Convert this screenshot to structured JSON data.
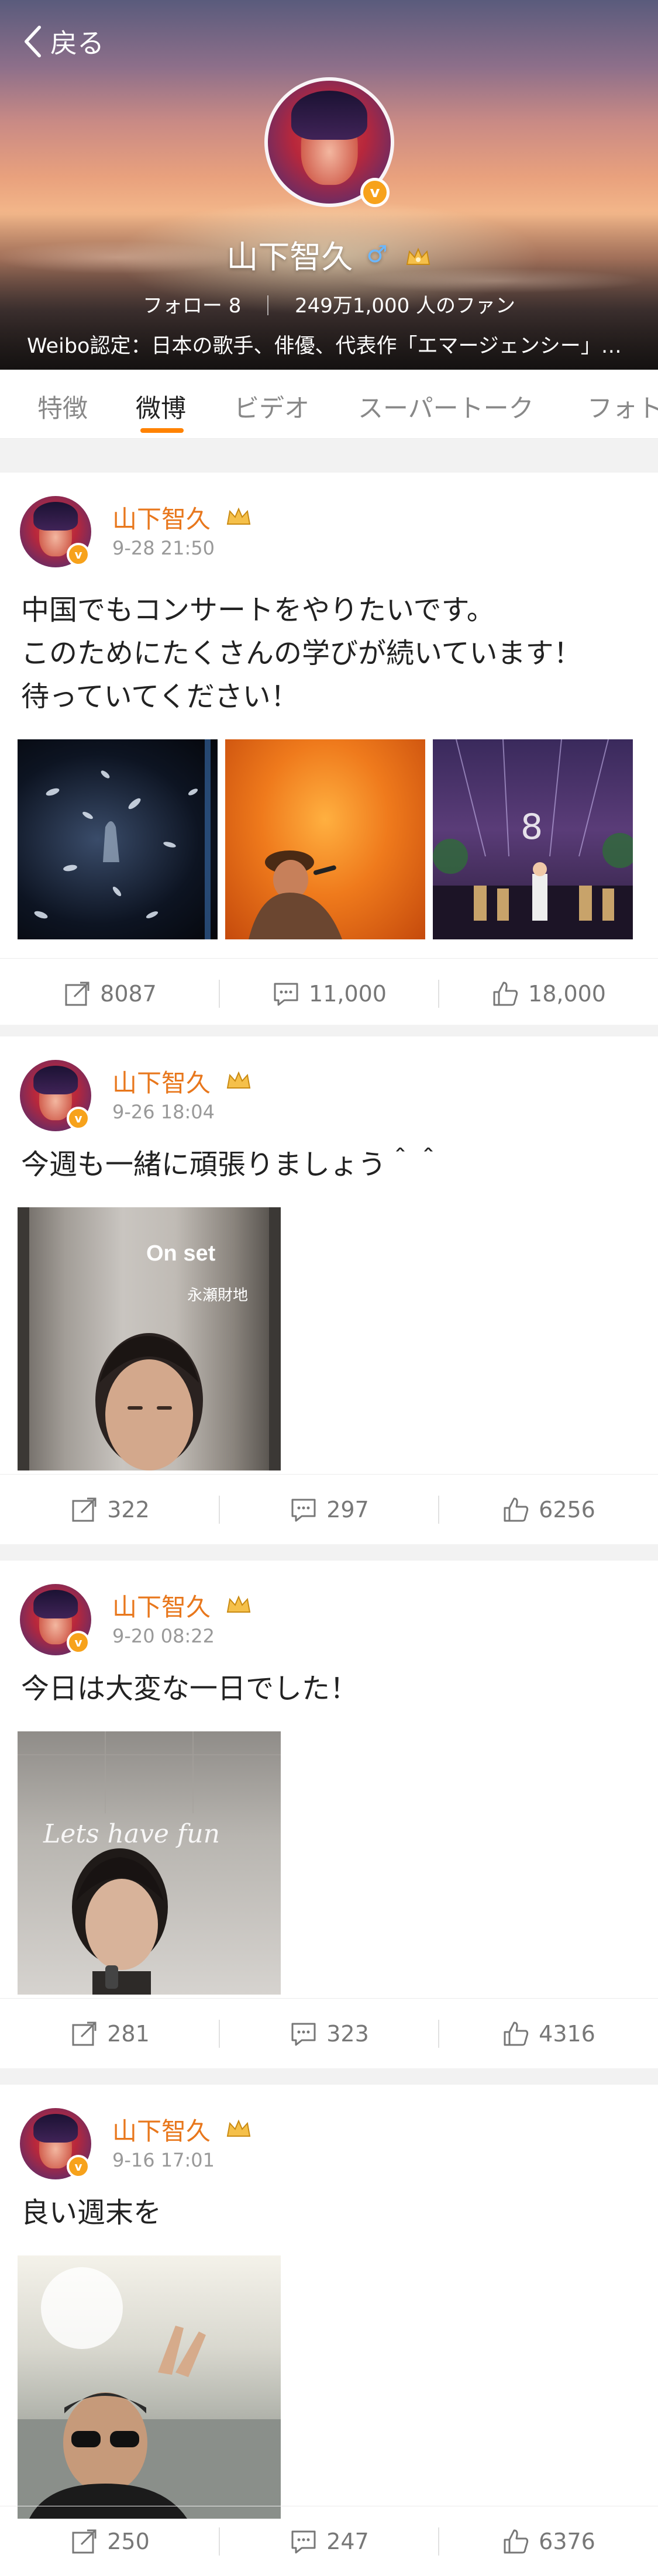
{
  "header": {
    "back_label": "戻る",
    "name": "山下智久",
    "gender_symbol": "♂",
    "verified_badge": "v",
    "follow_text": "フォロー 8",
    "fans_text": "249万1,000 人のファン",
    "verification": "Weibo認定：日本の歌手、俳優、代表作「エマージェンシー」…"
  },
  "tabs": [
    {
      "label": "特徴",
      "active": false
    },
    {
      "label": "微博",
      "active": true
    },
    {
      "label": "ビデオ",
      "active": false
    },
    {
      "label": "スーパートーク",
      "active": false
    },
    {
      "label": "フォト",
      "active": false
    }
  ],
  "posts": [
    {
      "author": "山下智久",
      "time": "9-28 21:50",
      "text": "中国でもコンサートをやりたいです。\nこのためにたくさんの学びが続いています！\n待っていてください！",
      "photos": [
        "concert-petals",
        "concert-singer-orange",
        "concert-stage-dancers"
      ],
      "reposts": "8087",
      "comments": "11,000",
      "likes": "18,000"
    },
    {
      "author": "山下智久",
      "time": "9-26 18:04",
      "text": "今週も一緒に頑張りましょう＾＾",
      "photos": [
        "elevator-selfie"
      ],
      "photo_overlay_title": "On set",
      "photo_overlay_sub": "永瀬財地",
      "reposts": "322",
      "comments": "297",
      "likes": "6256"
    },
    {
      "author": "山下智久",
      "time": "9-20 08:22",
      "text": "今日は大変な一日でした！",
      "photos": [
        "mirror-selfie"
      ],
      "photo_overlay_title": "Lets have fun",
      "reposts": "281",
      "comments": "323",
      "likes": "4316"
    },
    {
      "author": "山下智久",
      "time": "9-16 17:01",
      "text": "良い週末を",
      "photos": [
        "beach-selfie-sunglasses"
      ],
      "reposts": "250",
      "comments": "247",
      "likes": "6376"
    }
  ],
  "colors": {
    "accent": "#ff8200",
    "name_orange": "#e8771c",
    "badge": "#f7a21b",
    "gender_blue": "#6bb7ff"
  }
}
